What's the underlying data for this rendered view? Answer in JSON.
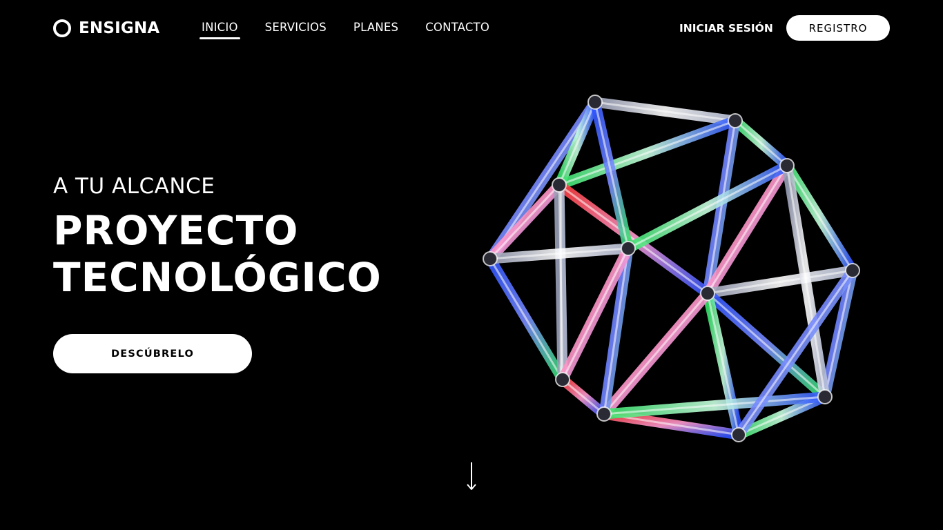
{
  "brand": {
    "name": "ENSIGNA",
    "logo_icon": "ring-icon"
  },
  "nav": {
    "items": [
      {
        "label": "INICIO",
        "active": true
      },
      {
        "label": "SERVICIOS",
        "active": false
      },
      {
        "label": "PLANES",
        "active": false
      },
      {
        "label": "CONTACTO",
        "active": false
      }
    ]
  },
  "auth": {
    "login_label": "INICIAR SESIÓN",
    "register_label": "REGISTRO"
  },
  "hero": {
    "eyebrow": "A TU ALCANCE",
    "headline_line1": "PROYECTO",
    "headline_line2": "TECNOLÓGICO",
    "cta_label": "DESCÚBRELO",
    "artwork_icon": "icosahedron-wireframe-icon"
  },
  "scroll_indicator": {
    "icon": "arrow-down-icon"
  },
  "colors": {
    "background": "#000000",
    "foreground": "#ffffff",
    "button_text": "#000000",
    "artwork_blue": "#2f54ff",
    "artwork_green": "#35e36a",
    "artwork_red": "#ff3b3b",
    "artwork_white": "#e8e8f0"
  }
}
